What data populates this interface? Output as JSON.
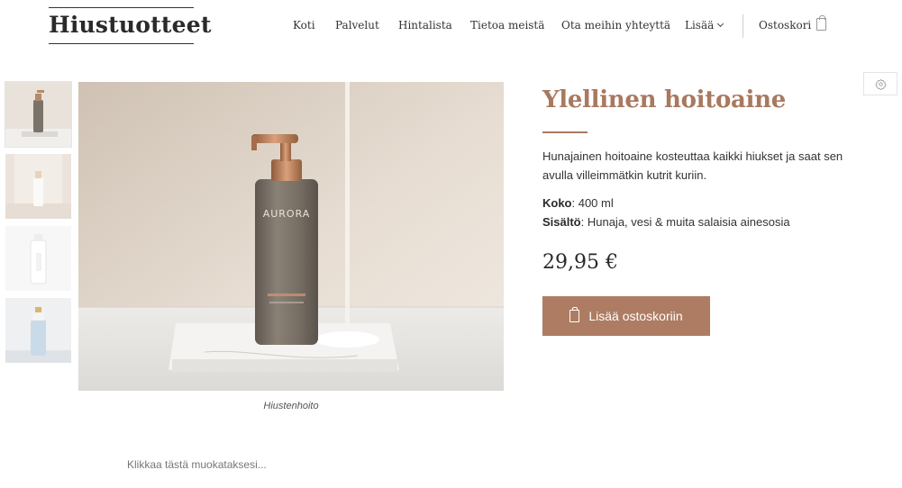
{
  "header": {
    "logo": "Hiustuotteet",
    "nav": [
      "Koti",
      "Palvelut",
      "Hintalista",
      "Tietoa meistä",
      "Ota meihin yhteyttä",
      "Lisää"
    ],
    "cart_label": "Ostoskori"
  },
  "product": {
    "title": "Ylellinen hoitoaine",
    "description": "Hunajainen hoitoaine kosteuttaa kaikki hiukset ja saat sen avulla villeimmätkin kutrit kuriin.",
    "size_label": "Koko",
    "size_value": ": 400 ml",
    "contents_label": "Sisältö",
    "contents_value": ": Hunaja, vesi & muita salaisia ainesosia",
    "price": "29,95 €",
    "add_to_cart": "Lisää ostoskoriin",
    "bottle_brand": "AURORA"
  },
  "gallery": {
    "caption": "Hiustenhoito",
    "thumbnail_count": 4
  },
  "footer": {
    "edit_hint": "Klikkaa tästä muokataksesi..."
  },
  "colors": {
    "accent": "#a8795f",
    "button": "#ad7c63",
    "text": "#333333"
  }
}
